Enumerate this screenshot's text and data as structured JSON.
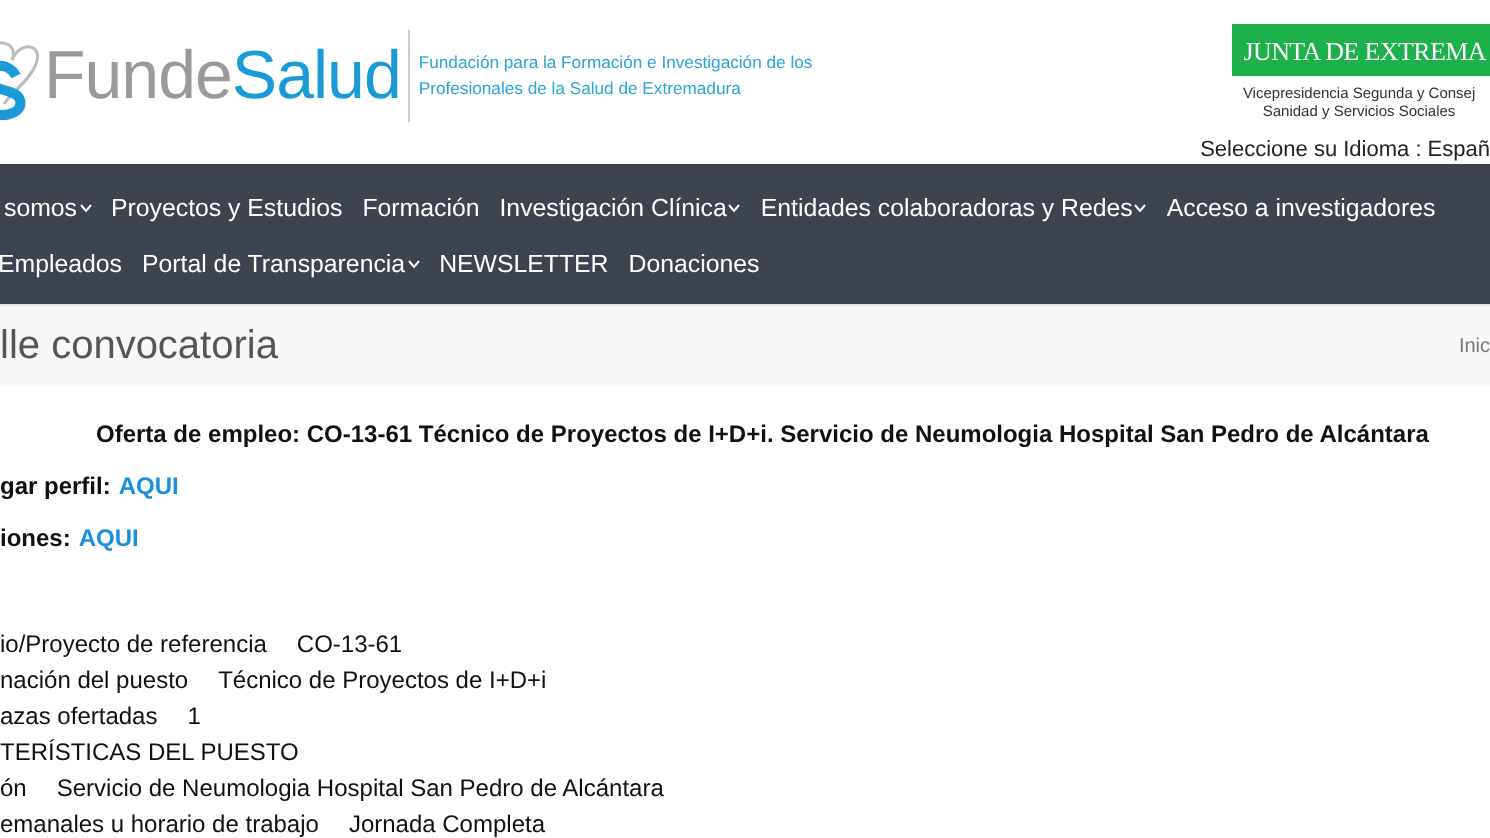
{
  "header": {
    "logo_text_light": "Funde",
    "logo_text_bold": "Salud",
    "tagline_lines": [
      "Fundación para la Formación e Investigación de los",
      "Profesionales de la Salud de Extremadura"
    ],
    "agency_badge": "JUNTA DE EXTREMA",
    "agency_lines": [
      "Vicepresidencia Segunda y Consej",
      "Sanidad y Servicios Sociales"
    ],
    "language_label": "Seleccione su Idioma :",
    "language_value": "Españ"
  },
  "nav": {
    "rows": [
      [
        {
          "label": "somos",
          "dropdown": true
        },
        {
          "label": "Proyectos y Estudios",
          "dropdown": false
        },
        {
          "label": "Formación",
          "dropdown": false
        },
        {
          "label": "Investigación Clínica",
          "dropdown": true
        },
        {
          "label": "Entidades colaboradoras y Redes",
          "dropdown": true
        },
        {
          "label": "Acceso a investigadores",
          "dropdown": false
        }
      ],
      [
        {
          "label": "Empleados",
          "dropdown": false
        },
        {
          "label": "Portal de Transparencia",
          "dropdown": true
        },
        {
          "label": "NEWSLETTER",
          "dropdown": false
        },
        {
          "label": "Donaciones",
          "dropdown": false
        }
      ]
    ]
  },
  "page_title": {
    "title": "lle convocatoria",
    "breadcrumb": "Inic"
  },
  "offer": {
    "heading": "Oferta de empleo: CO-13-61 Técnico de Proyectos de I+D+i. Servicio de Neumologia Hospital San Pedro de Alcántara",
    "links": [
      {
        "label": "gar perfil:",
        "link": "AQUI"
      },
      {
        "label": "iones:",
        "link": "AQUI"
      }
    ],
    "rows": [
      {
        "kind": "field",
        "label": "io/Proyecto  de referencia",
        "value": "CO-13-61"
      },
      {
        "kind": "field",
        "label": "nación del puesto",
        "value": "Técnico de Proyectos de I+D+i"
      },
      {
        "kind": "field",
        "label": "azas ofertadas",
        "value": "1"
      },
      {
        "kind": "heading",
        "label": "TERÍSTICAS DEL PUESTO"
      },
      {
        "kind": "field",
        "label": "ón",
        "value": "Servicio de Neumologia Hospital San Pedro de Alcántara"
      },
      {
        "kind": "field",
        "label": "emanales u horario de trabajo",
        "value": "Jornada Completa"
      }
    ]
  }
}
